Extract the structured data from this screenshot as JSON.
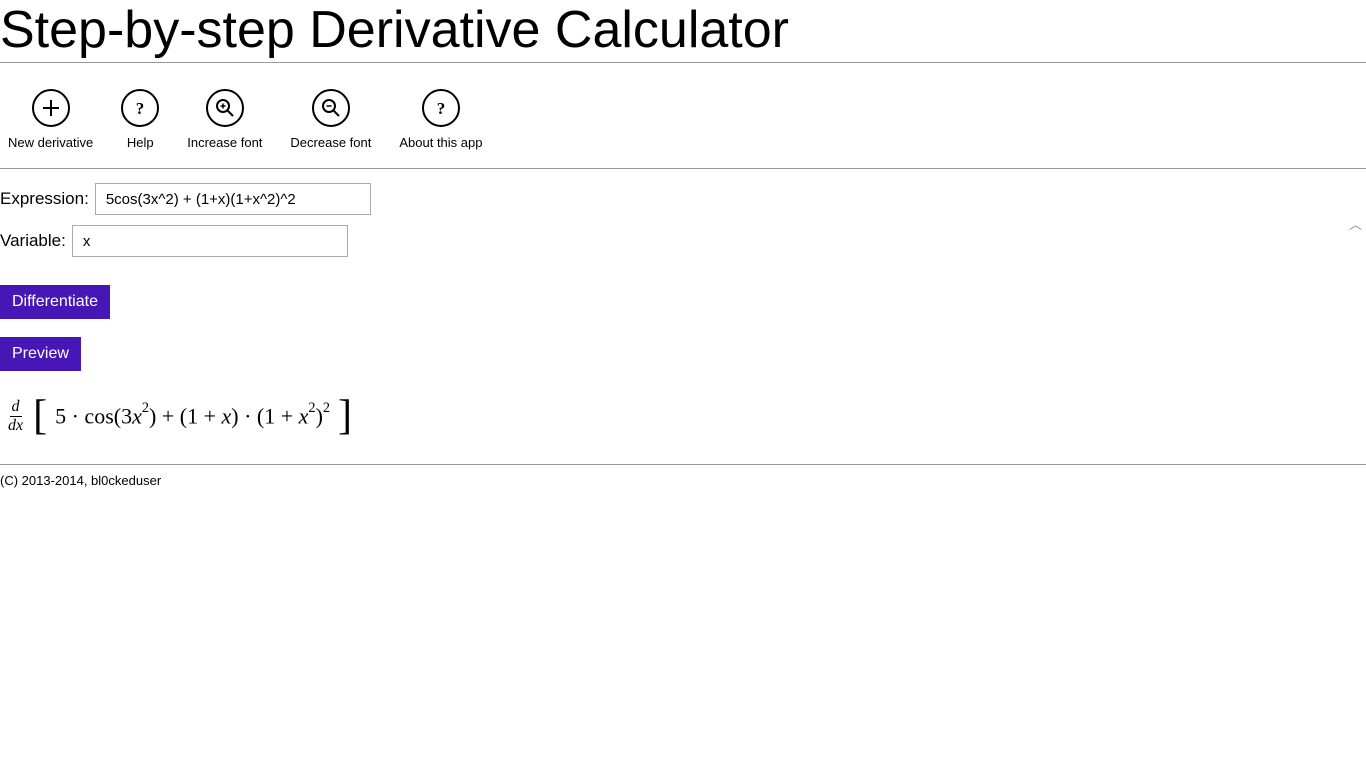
{
  "title": "Step-by-step Derivative Calculator",
  "toolbar": {
    "new": {
      "label": "New derivative"
    },
    "help": {
      "label": "Help"
    },
    "zoomin": {
      "label": "Increase font"
    },
    "zoomout": {
      "label": "Decrease font"
    },
    "about": {
      "label": "About this app"
    }
  },
  "form": {
    "expr_label": "Expression:",
    "expr_value": "5cos(3x^2) + (1+x)(1+x^2)^2",
    "var_label": "Variable:",
    "var_value": "x",
    "differentiate_label": "Differentiate",
    "preview_label": "Preview"
  },
  "footer": "(C) 2013-2014, bl0ckeduser",
  "colors": {
    "accent": "#4617B4"
  }
}
